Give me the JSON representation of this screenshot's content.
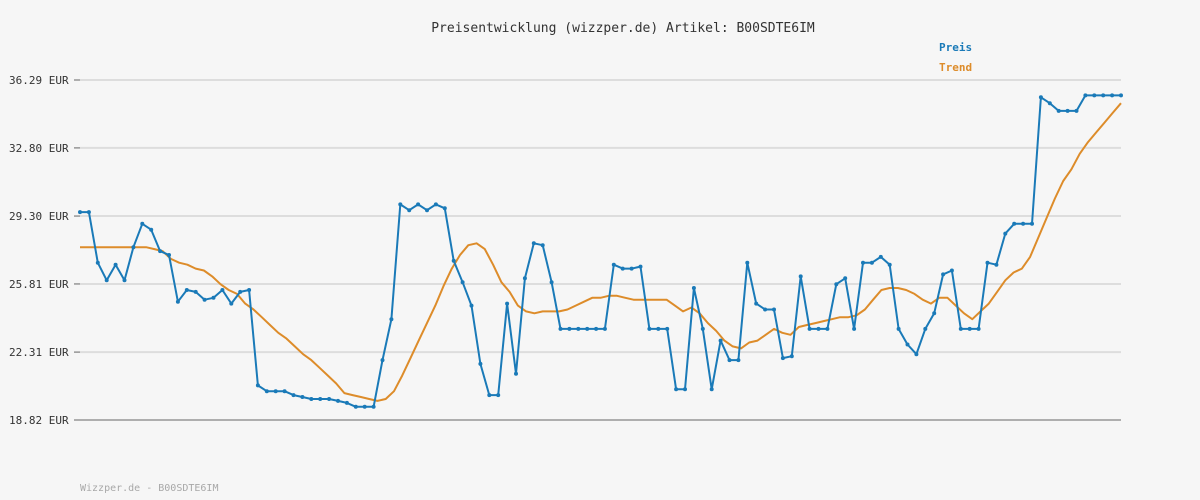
{
  "chart_data": {
    "type": "line",
    "title": "Preisentwicklung (wizzper.de) Artikel: B00SDTE6IM",
    "footer": "Wizzper.de - B00SDTE6IM",
    "ylim": [
      18.82,
      36.29
    ],
    "y_ticks": [
      "36.29 EUR",
      "32.80 EUR",
      "29.30 EUR",
      "25.81 EUR",
      "22.31 EUR",
      "18.82 EUR"
    ],
    "y_tick_values": [
      36.29,
      32.8,
      29.3,
      25.81,
      22.31,
      18.82
    ],
    "grid": true,
    "legend_position": "top-right",
    "series": [
      {
        "name": "Preis",
        "color": "#1a7ab8",
        "values": [
          29.5,
          29.5,
          26.9,
          26.0,
          26.8,
          26.0,
          27.7,
          28.9,
          28.6,
          27.5,
          27.3,
          24.9,
          25.5,
          25.4,
          25.0,
          25.1,
          25.5,
          24.8,
          25.4,
          25.5,
          20.6,
          20.3,
          20.3,
          20.3,
          20.1,
          20.0,
          19.9,
          19.9,
          19.9,
          19.8,
          19.7,
          19.5,
          19.5,
          19.5,
          21.9,
          24.0,
          29.9,
          29.6,
          29.9,
          29.6,
          29.9,
          29.7,
          27.0,
          25.9,
          24.7,
          21.7,
          20.1,
          20.1,
          24.8,
          21.2,
          26.1,
          27.9,
          27.8,
          25.9,
          23.5,
          23.5,
          23.5,
          23.5,
          23.5,
          23.5,
          26.8,
          26.6,
          26.6,
          26.7,
          23.5,
          23.5,
          23.5,
          20.4,
          20.4,
          25.6,
          23.5,
          20.4,
          22.9,
          21.9,
          21.9,
          26.9,
          24.8,
          24.5,
          24.5,
          22.0,
          22.1,
          26.2,
          23.5,
          23.5,
          23.5,
          25.8,
          26.1,
          23.5,
          26.9,
          26.9,
          27.2,
          26.8,
          23.5,
          22.7,
          22.2,
          23.5,
          24.3,
          26.3,
          26.5,
          23.5,
          23.5,
          23.5,
          26.9,
          26.8,
          28.4,
          28.9,
          28.9,
          28.9,
          35.4,
          35.1,
          34.7,
          34.7,
          34.7,
          35.5,
          35.5,
          35.5,
          35.5,
          35.5
        ]
      },
      {
        "name": "Trend",
        "color": "#dd8c2a",
        "values": [
          27.7,
          27.7,
          27.7,
          27.7,
          27.7,
          27.7,
          27.7,
          27.7,
          27.7,
          27.6,
          27.5,
          27.1,
          26.9,
          26.8,
          26.6,
          26.5,
          26.2,
          25.8,
          25.5,
          25.3,
          24.8,
          24.5,
          24.1,
          23.7,
          23.3,
          23.0,
          22.6,
          22.2,
          21.9,
          21.5,
          21.1,
          20.7,
          20.2,
          20.1,
          20.0,
          19.9,
          19.8,
          19.9,
          20.3,
          21.1,
          22.0,
          22.9,
          23.8,
          24.7,
          25.7,
          26.6,
          27.3,
          27.8,
          27.9,
          27.6,
          26.8,
          25.9,
          25.4,
          24.7,
          24.4,
          24.3,
          24.4,
          24.4,
          24.4,
          24.5,
          24.7,
          24.9,
          25.1,
          25.1,
          25.2,
          25.2,
          25.1,
          25.0,
          25.0,
          25.0,
          25.0,
          25.0,
          24.7,
          24.4,
          24.6,
          24.3,
          23.8,
          23.4,
          22.9,
          22.6,
          22.5,
          22.8,
          22.9,
          23.2,
          23.5,
          23.3,
          23.2,
          23.6,
          23.7,
          23.8,
          23.9,
          24.0,
          24.1,
          24.1,
          24.2,
          24.5,
          25.0,
          25.5,
          25.6,
          25.6,
          25.5,
          25.3,
          25.0,
          24.8,
          25.1,
          25.1,
          24.7,
          24.3,
          24.0,
          24.4,
          24.8,
          25.4,
          26.0,
          26.4,
          26.6,
          27.2,
          28.2,
          29.2,
          30.2,
          31.1,
          31.7,
          32.5,
          33.1,
          33.6,
          34.1,
          34.6,
          35.1
        ]
      }
    ]
  }
}
